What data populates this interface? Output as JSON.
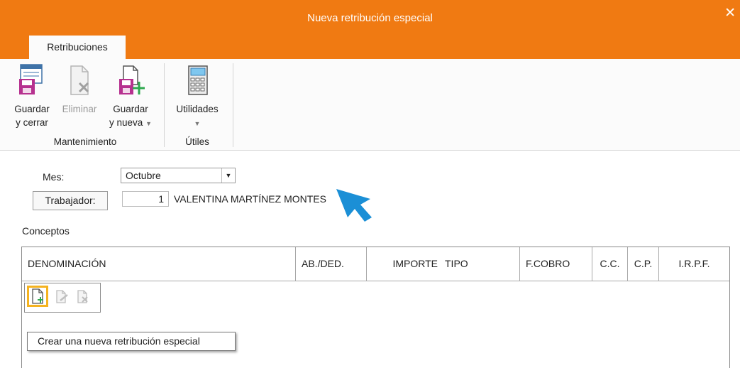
{
  "window": {
    "title": "Nueva retribución especial",
    "close_glyph": "✕"
  },
  "ribbon": {
    "tab": "Retribuciones",
    "groups": [
      {
        "label": "Mantenimiento",
        "buttons": [
          {
            "line1": "Guardar",
            "line2": "y cerrar",
            "icon": "save-close-icon"
          },
          {
            "line1": "Eliminar",
            "line2": "",
            "icon": "delete-doc-icon",
            "disabled": true
          },
          {
            "line1": "Guardar",
            "line2": "y nueva",
            "icon": "save-new-icon",
            "dropdown": true
          }
        ]
      },
      {
        "label": "Útiles",
        "buttons": [
          {
            "line1": "Utilidades",
            "line2": "",
            "icon": "calculator-icon",
            "dropdown": true
          }
        ]
      }
    ]
  },
  "form": {
    "mes_label": "Mes:",
    "mes_value": "Octubre",
    "trabajador_label": "Trabajador:",
    "trabajador_num": "1",
    "trabajador_name": "VALENTINA MARTÍNEZ MONTES",
    "conceptos_label": "Conceptos"
  },
  "table": {
    "columns": [
      "DENOMINACIÓN",
      "AB./DED.",
      "IMPORTE",
      "TIPO",
      "F.COBRO",
      "C.C.",
      "C.P.",
      "I.R.P.F."
    ]
  },
  "tooltip": "Crear una nueva retribución especial",
  "colors": {
    "accent": "#f07a12",
    "pointer": "#1b8fd6",
    "highlight": "#f5b320"
  }
}
